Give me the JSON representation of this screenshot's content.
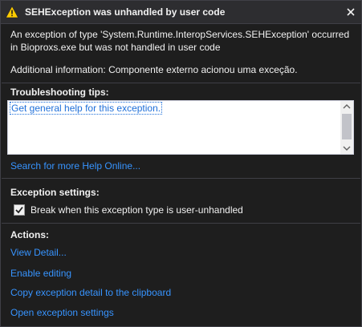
{
  "window": {
    "title": "SEHException was unhandled by user code",
    "close_label": "×"
  },
  "message": {
    "line1": "An exception of type 'System.Runtime.InteropServices.SEHException' occurred in Bioproxs.exe but was not handled in user code",
    "additional": "Additional information: Componente externo acionou uma exceção."
  },
  "troubleshooting": {
    "title": "Troubleshooting tips:",
    "tip_link": "Get general help for this exception.",
    "search_link": "Search for more Help Online..."
  },
  "exception_settings": {
    "title": "Exception settings:",
    "checkbox_label": "Break when this exception type is user-unhandled",
    "checked": true
  },
  "actions": {
    "title": "Actions:",
    "items": [
      {
        "label": "View Detail..."
      },
      {
        "label": "Enable editing"
      },
      {
        "label": "Copy exception detail to the clipboard"
      },
      {
        "label": "Open exception settings"
      }
    ]
  },
  "colors": {
    "background": "#1e1e1e",
    "titlebar": "#2d2d30",
    "link": "#3794ff",
    "warning": "#ffcc00"
  },
  "icons": {
    "warning": "warning-icon",
    "close": "close-icon",
    "checkmark": "checkmark-icon",
    "scroll_up": "chevron-up-icon",
    "scroll_down": "chevron-down-icon"
  }
}
